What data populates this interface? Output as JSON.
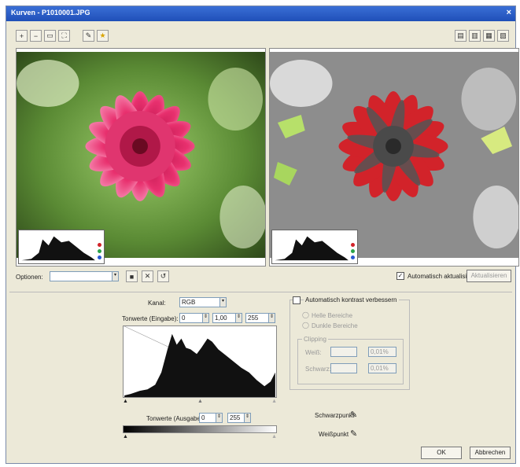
{
  "window": {
    "title": "Kurven - P1010001.JPG",
    "close_glyph": "×"
  },
  "toolbar": {
    "left_icons": [
      "zoom-in-icon",
      "zoom-out-icon",
      "fit-icon",
      "fullscreen-icon",
      "eyedropper-icon",
      "star-icon"
    ],
    "right_icons": [
      "view-single-icon",
      "view-split-icon",
      "view-horizontal-icon",
      "view-vertical-icon"
    ]
  },
  "presets": {
    "label": "Optionen:",
    "value": "",
    "auto_preview_label": "Automatisch aktualisiert",
    "auto_preview_checked": true,
    "refresh_label": "Aktualisieren"
  },
  "channel": {
    "label": "Kanal:",
    "value": "RGB"
  },
  "input_levels": {
    "label": "Tonwerte (Eingabe):",
    "low": "0",
    "mid": "1,00",
    "high": "255"
  },
  "output_levels": {
    "label": "Tonwerte (Ausgabe):",
    "low": "0",
    "high": "255"
  },
  "auto_contrast": {
    "label": "Automatisch kontrast verbessern",
    "option1": "Helle Bereiche",
    "option2": "Dunkle Bereiche",
    "clip_group_label": "Clipping",
    "white_label": "Weiß:",
    "black_label": "Schwarz:",
    "white_value": "0,01%",
    "black_value": "0,01%"
  },
  "pickers": {
    "black_label": "Schwarzpunkt",
    "white_label": "Weißpunkt"
  },
  "footer": {
    "ok_label": "OK",
    "cancel_label": "Abbrechen"
  },
  "colors": {
    "titlebar": "#1f4fb8",
    "dialog_bg": "#ece9d8",
    "clip_red": "#d2232a"
  }
}
